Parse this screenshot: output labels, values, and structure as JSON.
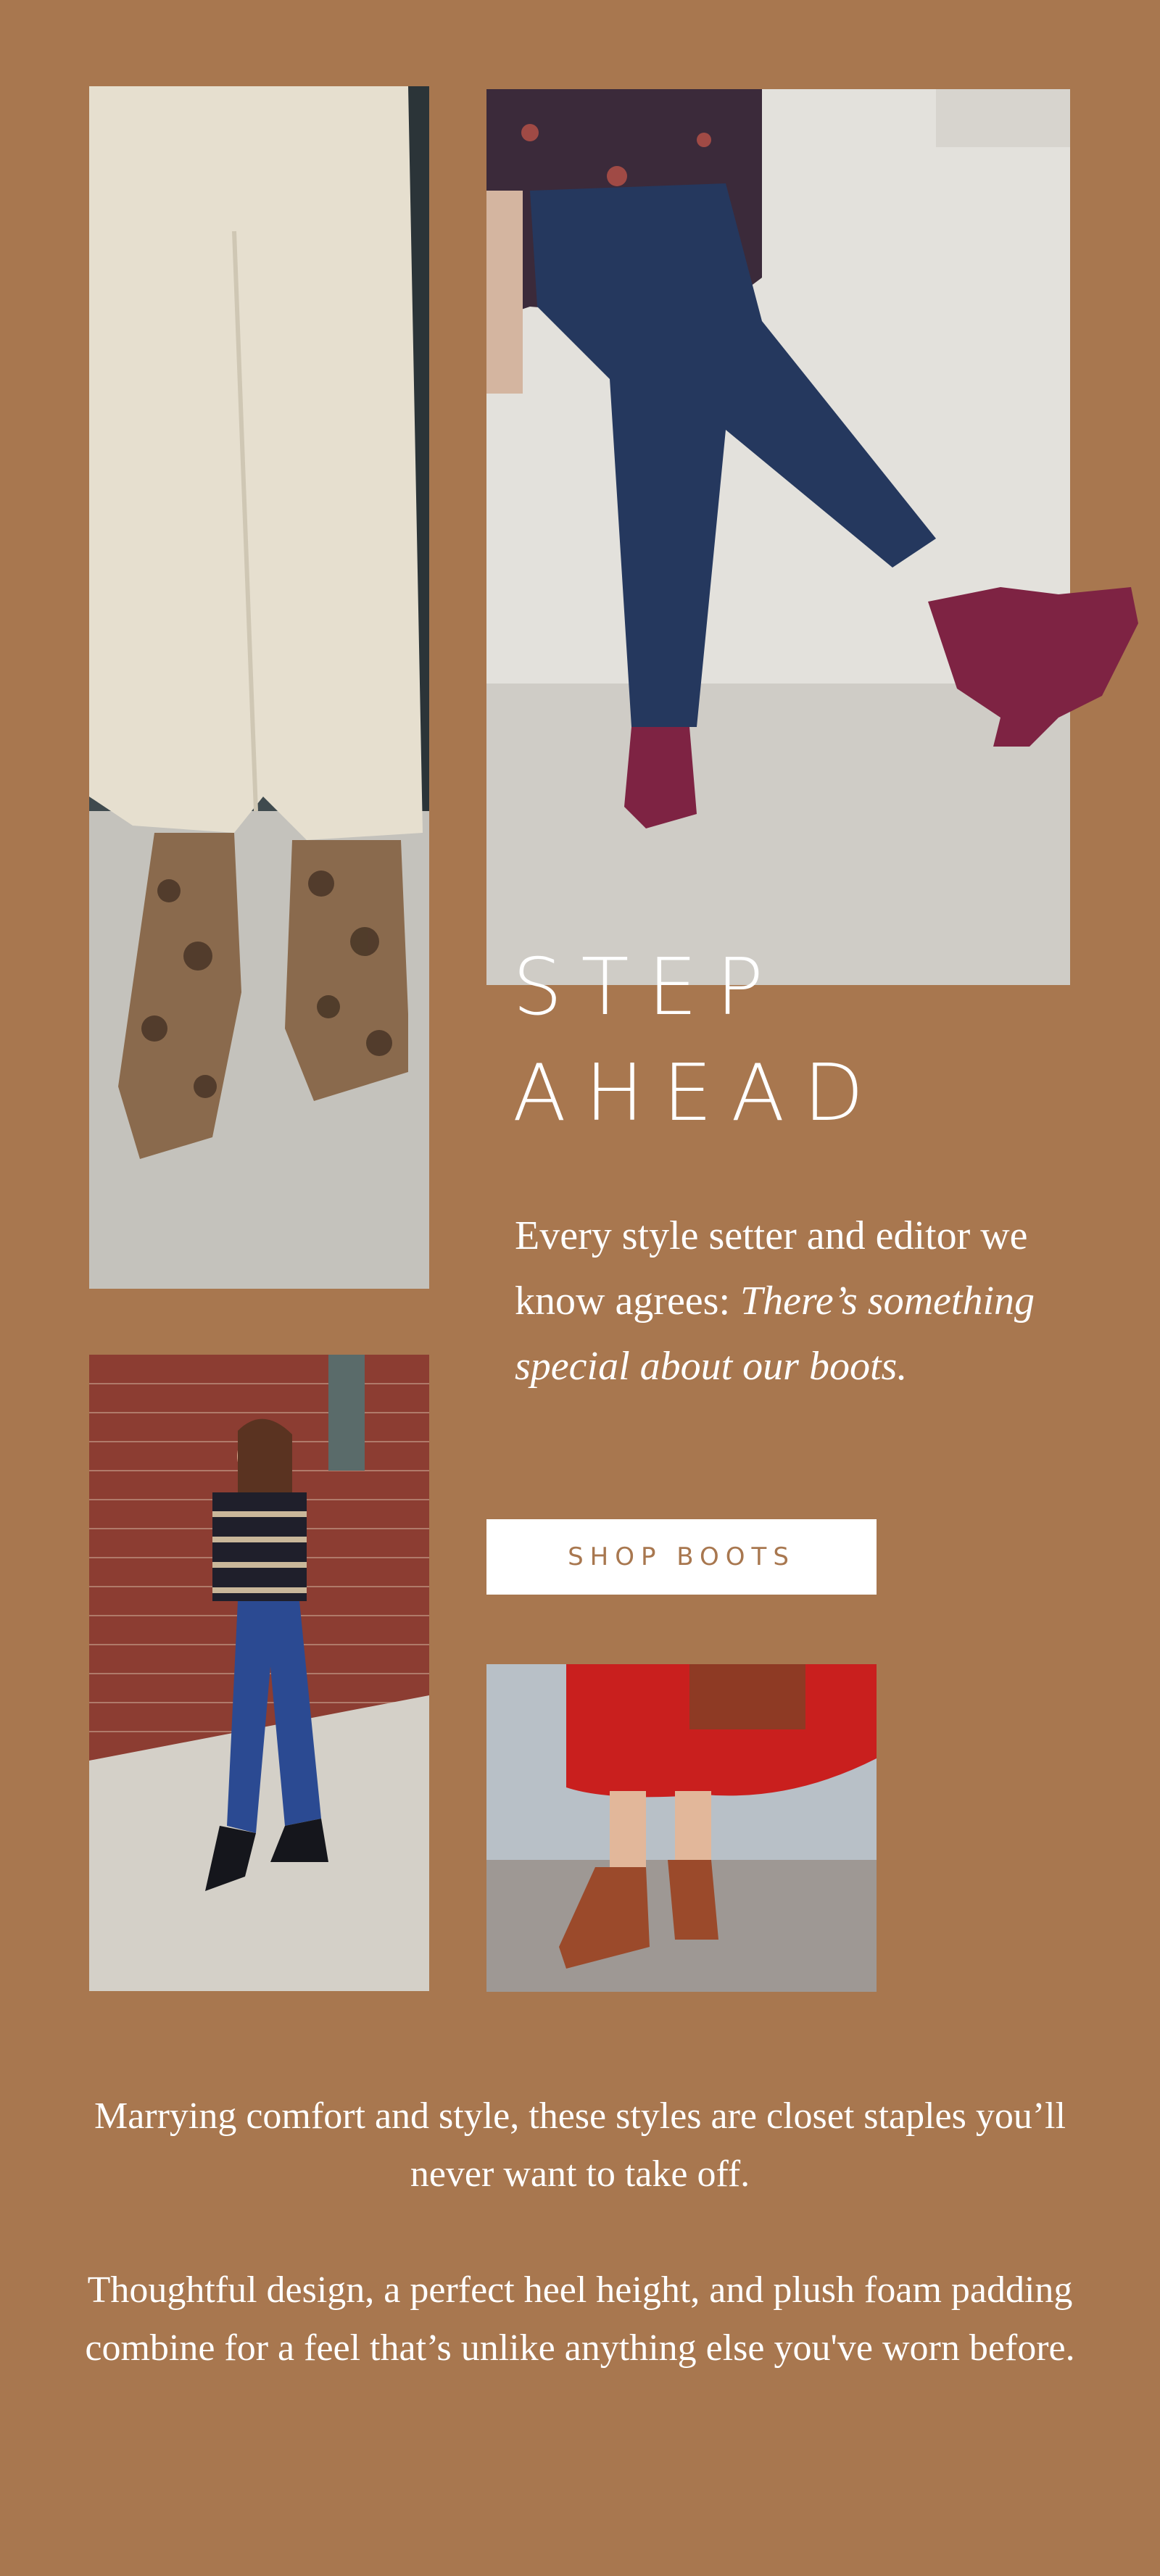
{
  "colors": {
    "background": "#A8774F",
    "text": "#FFFFFF",
    "button_background": "#FFFFFF",
    "button_text": "#A8774F"
  },
  "hero": {
    "headline_line1": "STEP",
    "headline_line2": "AHEAD",
    "intro_plain": "Every style setter and editor we know agrees:",
    "intro_italic": "There’s something special about our boots."
  },
  "cta": {
    "label": "SHOP BOOTS"
  },
  "images": {
    "snakeskin": "snakeskin-boots-photo",
    "denim": "burgundy-suede-boots-photo",
    "brick": "black-suede-boots-photo",
    "red_skirt": "rust-suede-boots-photo"
  },
  "body": {
    "paragraph1": "Marrying comfort and style, these styles are closet staples you’ll never want to take off.",
    "paragraph2": "Thoughtful design, a perfect heel height, and plush foam padding combine for a feel that’s unlike anything else you've worn before."
  }
}
